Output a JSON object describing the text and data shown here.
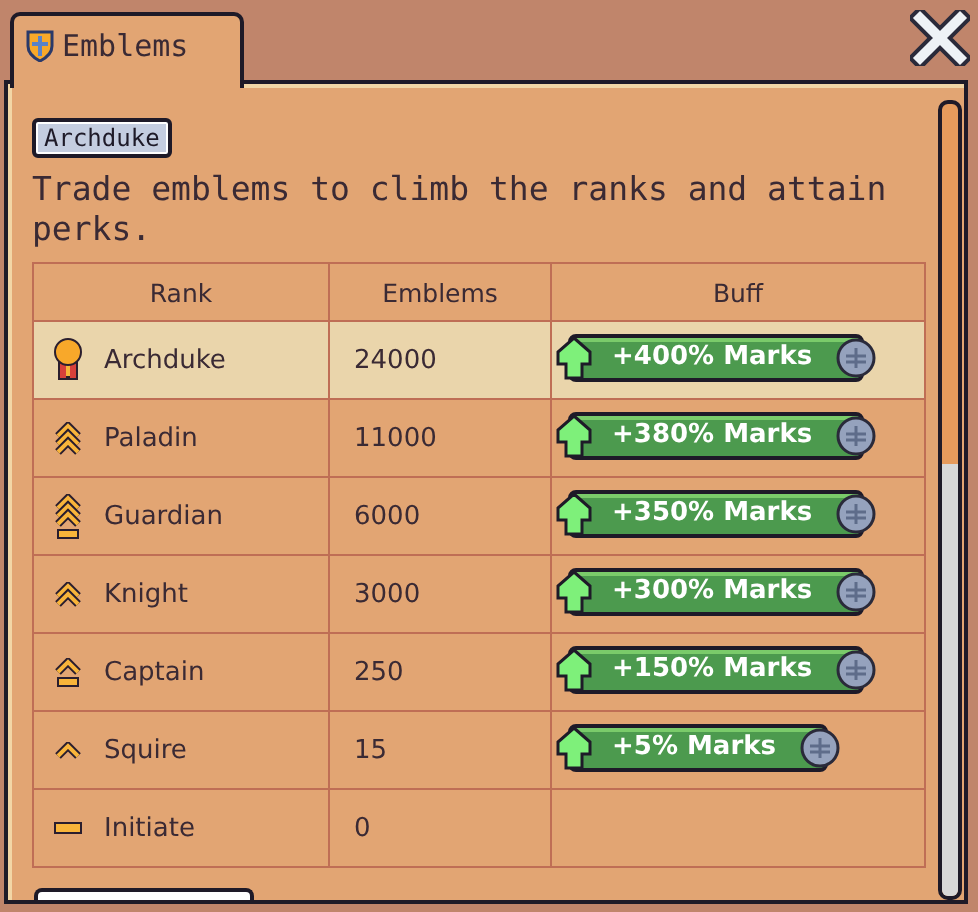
{
  "tab": {
    "label": "Emblems",
    "selected": true
  },
  "current_rank": "Archduke",
  "description": "Trade emblems to climb the ranks and attain perks.",
  "table": {
    "columns": [
      "Rank",
      "Emblems",
      "Buff"
    ],
    "rows": [
      {
        "kind": "medal",
        "rank": "Archduke",
        "emblems": "24000",
        "buff": "+400% Marks",
        "selected": true
      },
      {
        "kind": "chevron3",
        "rank": "Paladin",
        "emblems": "11000",
        "buff": "+380% Marks",
        "selected": false
      },
      {
        "kind": "chevron3bar",
        "rank": "Guardian",
        "emblems": "6000",
        "buff": "+350% Marks",
        "selected": false
      },
      {
        "kind": "chevron2",
        "rank": "Knight",
        "emblems": "3000",
        "buff": "+300% Marks",
        "selected": false
      },
      {
        "kind": "chevron1bar",
        "rank": "Captain",
        "emblems": "250",
        "buff": "+150% Marks",
        "selected": false
      },
      {
        "kind": "chevron1",
        "rank": "Squire",
        "emblems": "15",
        "buff": "+5% Marks",
        "selected": false
      },
      {
        "kind": "bar",
        "rank": "Initiate",
        "emblems": "0",
        "selected": false
      }
    ]
  }
}
